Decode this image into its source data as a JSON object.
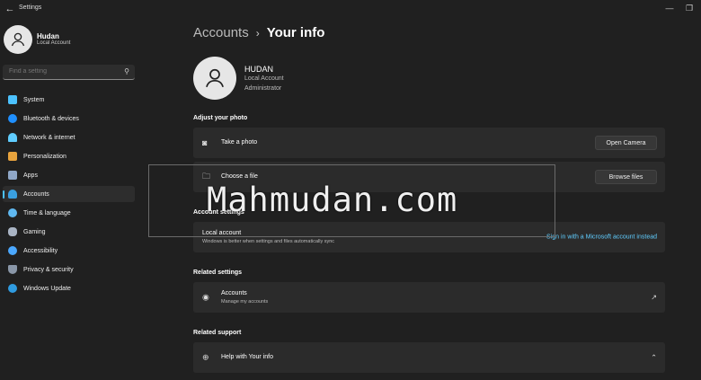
{
  "window": {
    "title": "Settings",
    "back_glyph": "←",
    "minimize_glyph": "—",
    "maximize_glyph": "❐"
  },
  "user": {
    "name": "Hudan",
    "account_type": "Local Account"
  },
  "search": {
    "placeholder": "Find a setting"
  },
  "nav": [
    {
      "label": "System",
      "icon": "monitor-icon",
      "color": "#4cc2ff"
    },
    {
      "label": "Bluetooth & devices",
      "icon": "bluetooth-icon",
      "color": "#1f8fff"
    },
    {
      "label": "Network & internet",
      "icon": "wifi-icon",
      "color": "#60cdff"
    },
    {
      "label": "Personalization",
      "icon": "brush-icon",
      "color": "#e8a33d"
    },
    {
      "label": "Apps",
      "icon": "apps-icon",
      "color": "#8fa7c7"
    },
    {
      "label": "Accounts",
      "icon": "person-icon",
      "color": "#3aa0e0",
      "active": true
    },
    {
      "label": "Time & language",
      "icon": "globe-clock-icon",
      "color": "#5fb8f0"
    },
    {
      "label": "Gaming",
      "icon": "gamepad-icon",
      "color": "#a9b4c4"
    },
    {
      "label": "Accessibility",
      "icon": "accessibility-icon",
      "color": "#4ba8ff"
    },
    {
      "label": "Privacy & security",
      "icon": "shield-icon",
      "color": "#8a97a8"
    },
    {
      "label": "Windows Update",
      "icon": "update-icon",
      "color": "#2f9be0"
    }
  ],
  "breadcrumb": {
    "parent": "Accounts",
    "separator": "›",
    "current": "Your info"
  },
  "profile": {
    "name": "HUDAN",
    "account_type": "Local Account",
    "role": "Administrator"
  },
  "adjust_photo": {
    "heading": "Adjust your photo",
    "take_photo": {
      "label": "Take a photo",
      "button": "Open Camera"
    },
    "choose_file": {
      "label": "Choose a file",
      "button": "Browse files"
    }
  },
  "account_settings": {
    "heading": "Account settings",
    "local_account": {
      "title": "Local account",
      "desc": "Windows is better when settings and files automatically sync",
      "link": "Sign in with a Microsoft account instead"
    }
  },
  "related_settings": {
    "heading": "Related settings",
    "accounts": {
      "title": "Accounts",
      "desc": "Manage my accounts"
    }
  },
  "related_support": {
    "heading": "Related support",
    "help": {
      "title": "Help with Your info"
    }
  },
  "watermark": {
    "text": "Mahmudan.com"
  },
  "colors": {
    "accent": "#4cc2ff",
    "link": "#60cdff",
    "background": "#202020",
    "card": "#2b2b2b"
  }
}
